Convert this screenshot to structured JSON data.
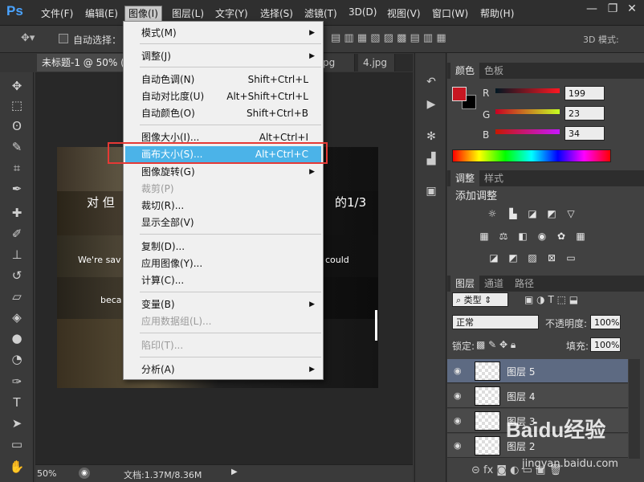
{
  "app": {
    "logo": "Ps"
  },
  "menubar": {
    "items": [
      "文件(F)",
      "编辑(E)",
      "图像(I)",
      "图层(L)",
      "文字(Y)",
      "选择(S)",
      "滤镜(T)",
      "3D(D)",
      "视图(V)",
      "窗口(W)",
      "帮助(H)"
    ]
  },
  "window_controls": {
    "minimize": "—",
    "restore": "❐",
    "close": "✕"
  },
  "options": {
    "auto_select_label": "自动选择：",
    "mode_3d_label": "3D 模式:"
  },
  "tabs": [
    {
      "label": "未标题-1 @ 50% ("
    },
    {
      "label": "pg"
    },
    {
      "label": "4.jpg"
    }
  ],
  "image_menu": {
    "items": [
      {
        "label": "模式(M)",
        "shortcut": "",
        "submenu": true,
        "disabled": false
      },
      {
        "label": "调整(J)",
        "shortcut": "",
        "submenu": true,
        "disabled": false
      },
      {
        "label": "自动色调(N)",
        "shortcut": "Shift+Ctrl+L",
        "disabled": false
      },
      {
        "label": "自动对比度(U)",
        "shortcut": "Alt+Shift+Ctrl+L",
        "disabled": false
      },
      {
        "label": "自动颜色(O)",
        "shortcut": "Shift+Ctrl+B",
        "disabled": false
      },
      {
        "label": "图像大小(I)...",
        "shortcut": "Alt+Ctrl+I",
        "disabled": false
      },
      {
        "label": "画布大小(S)...",
        "shortcut": "Alt+Ctrl+C",
        "disabled": false,
        "selected": true
      },
      {
        "label": "图像旋转(G)",
        "shortcut": "",
        "submenu": true,
        "disabled": false
      },
      {
        "label": "裁剪(P)",
        "shortcut": "",
        "disabled": true
      },
      {
        "label": "裁切(R)...",
        "shortcut": "",
        "disabled": false
      },
      {
        "label": "显示全部(V)",
        "shortcut": "",
        "disabled": false
      },
      {
        "label": "复制(D)...",
        "shortcut": "",
        "disabled": false
      },
      {
        "label": "应用图像(Y)...",
        "shortcut": "",
        "disabled": false
      },
      {
        "label": "计算(C)...",
        "shortcut": "",
        "disabled": false
      },
      {
        "label": "变量(B)",
        "shortcut": "",
        "submenu": true,
        "disabled": false
      },
      {
        "label": "应用数据组(L)...",
        "shortcut": "",
        "disabled": true
      },
      {
        "label": "陷印(T)...",
        "shortcut": "",
        "disabled": true
      },
      {
        "label": "分析(A)",
        "shortcut": "",
        "submenu": true,
        "disabled": false
      }
    ]
  },
  "canvas_text": {
    "line1": "对 但",
    "line1b": "的1/3",
    "line2": "We're sav",
    "line2b": "could",
    "line3": "beca"
  },
  "status": {
    "zoom": "50%",
    "doc_info": "文档:1.37M/8.36M"
  },
  "color_panel": {
    "tabs": [
      "颜色",
      "色板"
    ],
    "r_label": "R",
    "g_label": "G",
    "b_label": "B",
    "r": "199",
    "g": "23",
    "b": "34",
    "foreground": "#c71722",
    "background": "#000000"
  },
  "adjust_panel": {
    "tabs": [
      "调整",
      "样式"
    ],
    "title": "添加调整"
  },
  "layers_panel": {
    "tabs": [
      "图层",
      "通道",
      "路径"
    ],
    "filter_kind": "类型",
    "blend_mode": "正常",
    "opacity_label": "不透明度:",
    "opacity": "100%",
    "lock_label": "锁定:",
    "fill_label": "填充:",
    "fill": "100%",
    "layers": [
      {
        "name": "图层 5",
        "selected": true
      },
      {
        "name": "图层 4"
      },
      {
        "name": "图层 3"
      },
      {
        "name": "图层 2"
      }
    ]
  },
  "watermark": {
    "brand": "Baidu经验",
    "url": "jingyan.baidu.com"
  }
}
